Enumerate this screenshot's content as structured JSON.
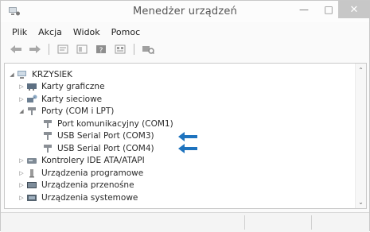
{
  "window": {
    "title": "Menedżer urządzeń"
  },
  "menu": {
    "items": [
      "Plik",
      "Akcja",
      "Widok",
      "Pomoc"
    ]
  },
  "toolbar": {
    "icons": [
      "back-icon",
      "forward-icon",
      "properties-icon",
      "show-hide-console-tree-icon",
      "help-icon",
      "view-icon",
      "scan-hardware-icon"
    ]
  },
  "tree": {
    "root": "KRZYSIEK",
    "items": [
      {
        "label": "Karty graficzne",
        "icon": "display-adapter-icon"
      },
      {
        "label": "Karty sieciowe",
        "icon": "network-adapter-icon"
      },
      {
        "label": "Porty (COM i LPT)",
        "icon": "port-icon"
      },
      {
        "label": "Port komunikacyjny (COM1)",
        "icon": "port-device-icon"
      },
      {
        "label": "USB Serial Port (COM3)",
        "icon": "port-device-icon"
      },
      {
        "label": "USB Serial Port (COM4)",
        "icon": "port-device-icon"
      },
      {
        "label": "Kontrolery IDE ATA/ATAPI",
        "icon": "ide-controller-icon"
      },
      {
        "label": "Urządzenia programowe",
        "icon": "software-device-icon"
      },
      {
        "label": "Urządzenia przenośne",
        "icon": "portable-device-icon"
      },
      {
        "label": "Urządzenia systemowe",
        "icon": "system-device-icon"
      }
    ]
  },
  "colors": {
    "arrow": "#1e73be",
    "close_button": "#c7c7c7"
  }
}
